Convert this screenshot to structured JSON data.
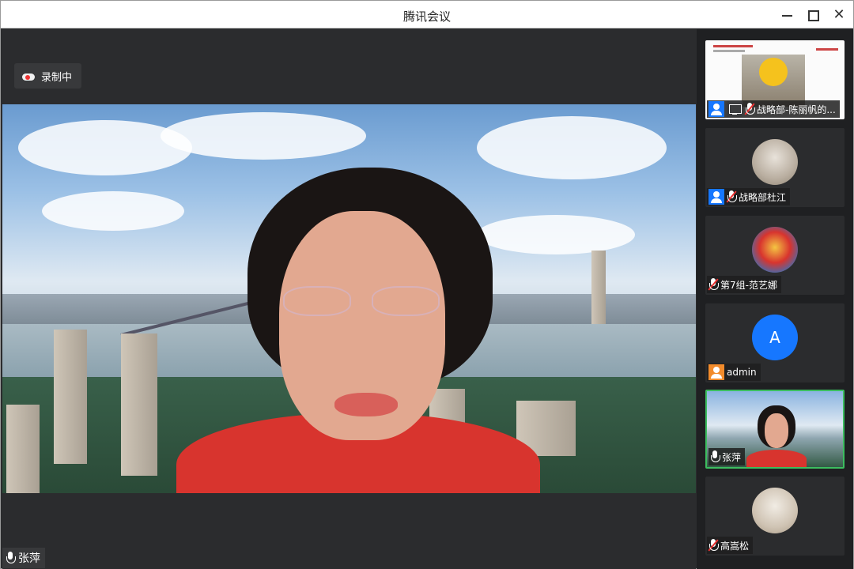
{
  "window": {
    "title": "腾讯会议",
    "close_glyph": "✕"
  },
  "stage": {
    "recording_label": "录制中",
    "speaker_name": "张萍"
  },
  "participants": [
    {
      "name": "战略部-陈丽帆的...",
      "type": "screen-share"
    },
    {
      "name": "战略部杜江",
      "type": "avatar-photo"
    },
    {
      "name": "第7组-范艺娜",
      "type": "avatar-photo"
    },
    {
      "name": "admin",
      "type": "letter-avatar",
      "letter": "A"
    },
    {
      "name": "张萍",
      "type": "video",
      "active": true
    },
    {
      "name": "高嵩松",
      "type": "avatar-photo"
    }
  ],
  "colors": {
    "accent_blue": "#1677ff",
    "active_border": "#3cbd5f",
    "muted_red": "#e33333",
    "admin_badge": "#f28b2b"
  }
}
